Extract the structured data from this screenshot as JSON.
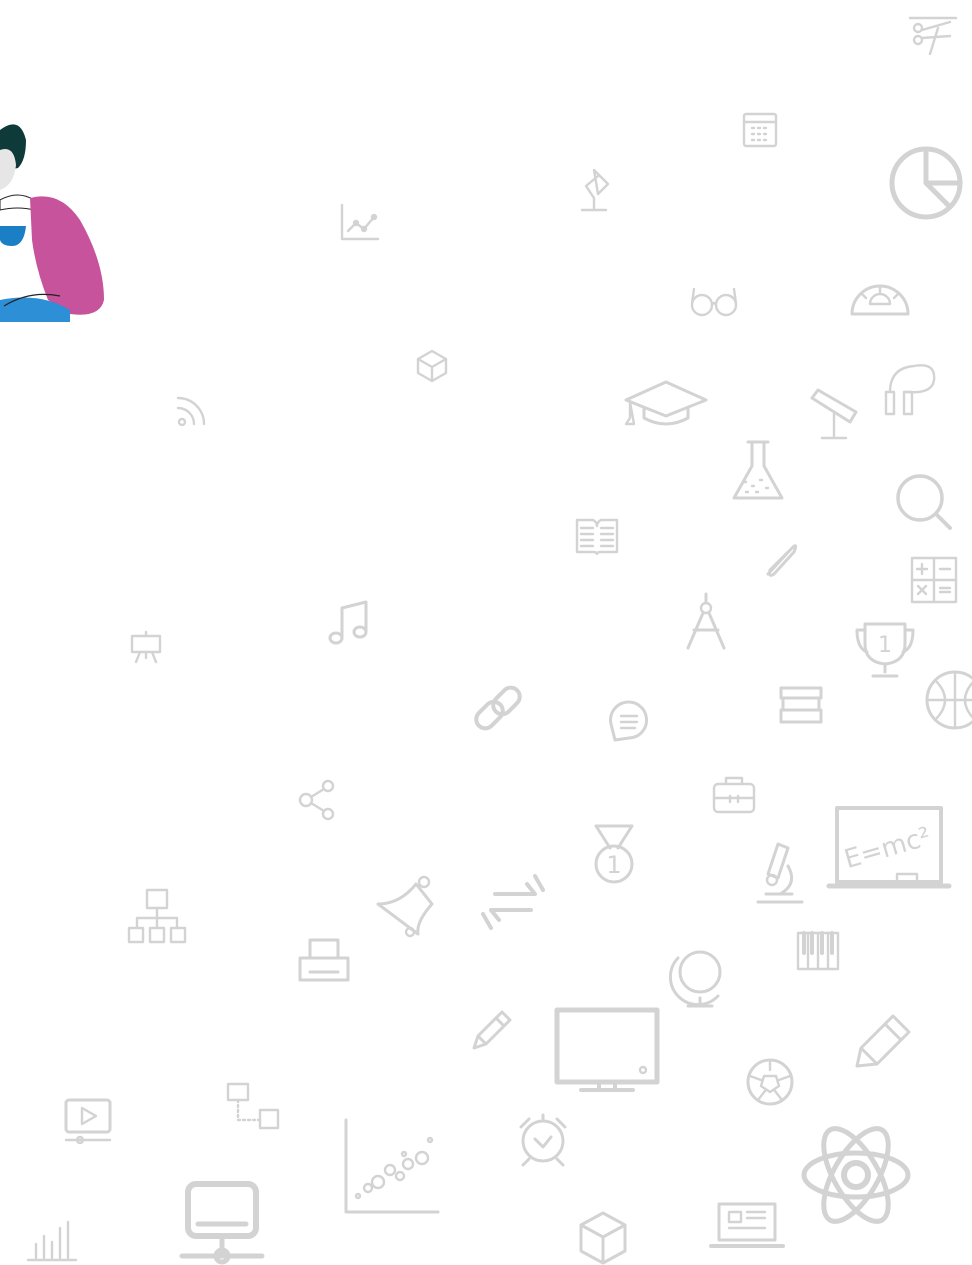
{
  "scene": {
    "background": "#ffffff",
    "icon_color": "#d3d3d3",
    "illustration": {
      "hair": "#0f3a3a",
      "skin": "#e6e6e6",
      "cup": "#1a7fc4",
      "sleeve": "#c7539d",
      "laptop": "#2d8fd6"
    },
    "blackboard_text": "E=mc²",
    "medal_number": "1",
    "trophy_number": "1"
  }
}
